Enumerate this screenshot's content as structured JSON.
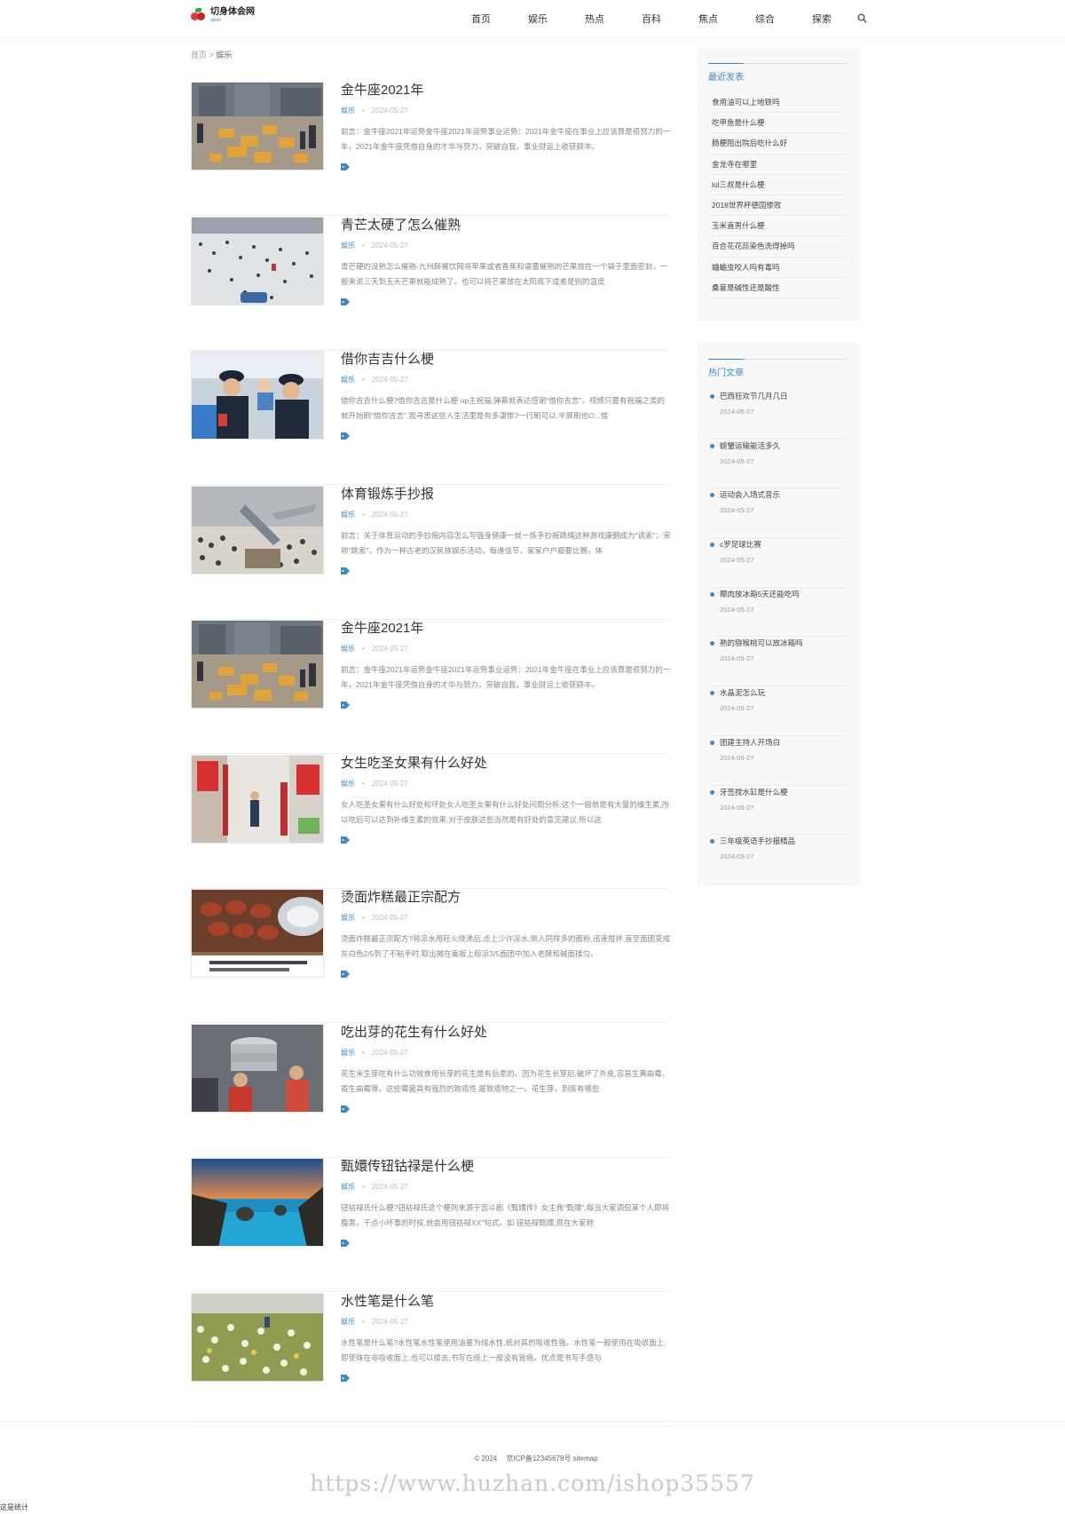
{
  "site": {
    "name": "切身体会网",
    "subname": "qiesh"
  },
  "nav": [
    "首页",
    "娱乐",
    "热点",
    "百科",
    "焦点",
    "综合",
    "探索"
  ],
  "breadcrumb": {
    "home": "首页",
    "sep": ">",
    "current": "娱乐"
  },
  "articles": [
    {
      "title": "金牛座2021年",
      "category": "娱乐",
      "date": "2024-05-27",
      "excerpt": "前言：金牛座2021年运势金牛座2021年运势事业运势：2021年金牛座在事业上应该算是很努力的一年，2021年金牛座凭借自身的才华与努力，突破自我，事业财运上收获颇丰。",
      "image": "street-crowd-parcels"
    },
    {
      "title": "青芒太硬了怎么催熟",
      "category": "娱乐",
      "date": "2024-05-27",
      "excerpt": "青芒硬的没熟怎么催熟-九州醉餐饮网将苹果或者香蕉和需要催熟的芒果放在一个袋子里面密封，一般来说三天到五天芒果就能成熟了。也可以将芒果放在太阳底下或者是别的温度",
      "image": "frozen-river-crowd"
    },
    {
      "title": "借你吉吉什么梗",
      "category": "娱乐",
      "date": "2024-05-27",
      "excerpt": "借你吉吉什么梗?借你吉吉是什么梗 up主祝福,弹幕就表达感谢\"借你吉言\"。视频只要有祝福之类的就开始刷\"借你吉言\".我寻思这些人生活里是有多凄惨?一行刷可以,半屏刷也O...借",
      "image": "police-with-child"
    },
    {
      "title": "体育锻炼手抄报",
      "category": "娱乐",
      "date": "2024-05-27",
      "excerpt": "前言：关于体育运动的手抄报内容怎么写强身健康一就一炼手抄报跳绳这种游戏康朝成为\"诱索\"：宋称\"跳索\"，作为一种古老的汉民族娱乐活动，每逢佳节，家家户户都要比赛。体",
      "image": "crash-site"
    },
    {
      "title": "金牛座2021年",
      "category": "娱乐",
      "date": "2024-05-27",
      "excerpt": "前言：金牛座2021年运势金牛座2021年运势事业运势：2021年金牛座在事业上应该算是很努力的一年，2021年金牛座凭借自身的才华与努力，突破自我，事业财运上收获颇丰。",
      "image": "street-crowd-parcels"
    },
    {
      "title": "女生吃圣女果有什么好处",
      "category": "娱乐",
      "date": "2024-05-27",
      "excerpt": "女人吃圣女果有什么好处和坏处女人吃圣女果有什么好处问题分析:这个一般就是有大量的维生素,所以吃后可以达到补维生素的效果,对于皮肤这些当然是有好处的意见建议:所以这",
      "image": "alley-red-posters"
    },
    {
      "title": "烫面炸糕最正宗配方",
      "category": "娱乐",
      "date": "2024-05-27",
      "excerpt": "烫面炸糕最正宗配方?将凉水用旺火烧沸后,点上少许凉水,倒入同样多的面粉,迅速搅拌,直至面团变成灰白色2/5到了不粘手时,取出摊在案板上晾凉3/5面团中加入老酵和碱面揉匀。",
      "image": "fried-cakes"
    },
    {
      "title": "吃出芽的花生有什么好处",
      "category": "娱乐",
      "date": "2024-05-27",
      "excerpt": "花生米生芽吃有什么功效食用长芽的花生是有后患的。因为花生长芽后,破坏了外皮,容易生黄曲霉、寄生曲霉等。这些霉菌具有强烈的致癌性,屡致癌物之一。花生芽，到底有哪些",
      "image": "kitchen-steamers"
    },
    {
      "title": "甄嬛传钮钴禄是什么梗",
      "category": "娱乐",
      "date": "2024-05-27",
      "excerpt": "钮祜禄氏什么梗?钮祜禄氏这个梗则来源于宫斗剧《甄嬛传》女主角\"甄嬛\",每当大家调侃某个人即将腹黑，干点小坏事的时候,就会用钮祜禄XX\"句式。如 钮祜禄甄嬛,现在大家称",
      "image": "sea-rocks"
    },
    {
      "title": "水性笔是什么笔",
      "category": "娱乐",
      "date": "2024-05-27",
      "excerpt": "水性笔是什么笔?水性笔水性笔使用油墨为纯水性,纸对其的吸收性强。水性笔一般使用在吸收面上,即使珠在非吸收面上,也可以擦去,书写在纸上一般没有背痕。优点是书写手感与",
      "image": "flower-field"
    }
  ],
  "sidebar": {
    "recent": {
      "title": "最近发表",
      "items": [
        "食用油可以上地铁吗",
        "吃甲鱼是什么梗",
        "肠梗阻出院后吃什么好",
        "金龙寺在哪里",
        "lol三叔是什么梗",
        "2018世界杯德国惨败",
        "玉米直男什么梗",
        "百合花花蕊染色洗得掉吗",
        "蛐蛐虫咬人吗有毒吗",
        "桑葚是碱性还是酸性"
      ]
    },
    "hot": {
      "title": "热门文章",
      "items": [
        {
          "title": "巴西狂欢节几月几日",
          "date": "2024-05-27"
        },
        {
          "title": "螃蟹运输能活多久",
          "date": "2024-05-27"
        },
        {
          "title": "运动会入场式音乐",
          "date": "2024-05-27"
        },
        {
          "title": "c罗足球比赛",
          "date": "2024-05-27"
        },
        {
          "title": "椰肉放冰箱5天还能吃吗",
          "date": "2024-05-27"
        },
        {
          "title": "熟的猕猴桃可以放冰箱吗",
          "date": "2024-05-27"
        },
        {
          "title": "水晶泥怎么玩",
          "date": "2024-05-27"
        },
        {
          "title": "团建主持人开场白",
          "date": "2024-05-27"
        },
        {
          "title": "牙签搅水缸是什么梗",
          "date": "2024-05-27"
        },
        {
          "title": "三年级英语手抄报精品",
          "date": "2024-05-27"
        }
      ]
    }
  },
  "footer": {
    "copyright": "© 2024",
    "icp": "京ICP备12345678号",
    "sitemap": "sitemap"
  },
  "watermark": "https://www.huzhan.com/ishop35557",
  "stat_text": "这是统计",
  "colors": {
    "accent": "#3a8acb",
    "border": "#eeeeee",
    "sidebar_bg": "#f8f8f8"
  }
}
